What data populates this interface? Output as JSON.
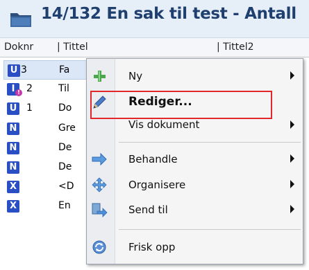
{
  "window": {
    "title": "14/132 En sak til test - Antall",
    "icon": "folder-icon"
  },
  "columns": {
    "doknr": "Doknr",
    "tittel": "| Tittel",
    "tittel2": "| Tittel2"
  },
  "rows": [
    {
      "badge": "U",
      "overlay": "",
      "num": "3",
      "title": "Fa",
      "color": "#2a4fc4"
    },
    {
      "badge": "I",
      "overlay": "",
      "num": "2",
      "title": "Til",
      "color": "#2a4fc4"
    },
    {
      "badge": "U",
      "overlay": "",
      "num": "1",
      "title": "Do",
      "color": "#2a4fc4"
    },
    {
      "badge": "N",
      "overlay": "",
      "num": "",
      "title": "Gre",
      "color": "#2a4fc4"
    },
    {
      "badge": "N",
      "overlay": "",
      "num": "",
      "title": "De",
      "color": "#2a4fc4"
    },
    {
      "badge": "N",
      "overlay": "",
      "num": "",
      "title": "De",
      "color": "#2a4fc4"
    },
    {
      "badge": "X",
      "overlay": "",
      "num": "",
      "title": "<D",
      "color": "#2a4fc4"
    },
    {
      "badge": "X",
      "overlay": "",
      "num": "",
      "title": "En",
      "color": "#2a4fc4"
    }
  ],
  "context_menu": {
    "items": [
      {
        "label": "Ny",
        "icon": "plus-icon",
        "submenu": true
      },
      {
        "label": "Rediger...",
        "icon": "pencil-icon",
        "submenu": false
      },
      {
        "label": "Vis dokument",
        "icon": "",
        "submenu": true
      },
      {
        "label": "Behandle",
        "icon": "forward-arrow-icon",
        "submenu": true
      },
      {
        "label": "Organisere",
        "icon": "move-icon",
        "submenu": true
      },
      {
        "label": "Send til",
        "icon": "send-icon",
        "submenu": true
      },
      {
        "label": "Frisk opp",
        "icon": "refresh-icon",
        "submenu": false
      }
    ]
  },
  "colors": {
    "title_text": "#1f3f6e",
    "badge": "#2a4fc4",
    "highlight": "#e2262a"
  }
}
